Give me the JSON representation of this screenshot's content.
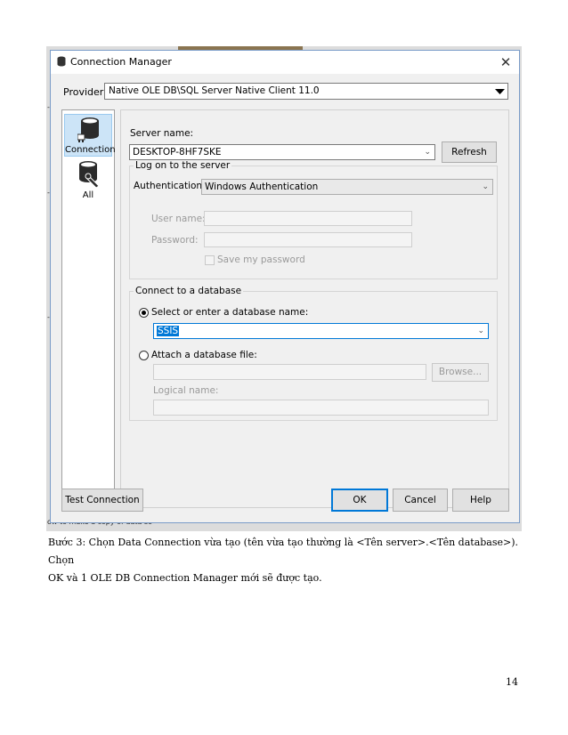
{
  "window": {
    "title": "Connection Manager",
    "close_symbol": "✕"
  },
  "provider": {
    "label": "Provider:",
    "value": "Native OLE DB\\SQL Server Native Client 11.0"
  },
  "nav": {
    "items": [
      {
        "label": "Connection",
        "icon": "database-plug-icon",
        "selected": true
      },
      {
        "label": "All",
        "icon": "database-wrench-icon",
        "selected": false
      }
    ]
  },
  "server": {
    "label": "Server name:",
    "value": "DESKTOP-8HF7SKE",
    "refresh_label": "Refresh"
  },
  "logon": {
    "group_label": "Log on to the server",
    "auth_label": "Authentication:",
    "auth_value": "Windows Authentication",
    "username_label": "User name:",
    "password_label": "Password:",
    "save_password_label": "Save my password"
  },
  "database": {
    "group_label": "Connect to a database",
    "select_label": "Select or enter a database name:",
    "select_value": "SSIS",
    "attach_label": "Attach a database file:",
    "browse_label": "Browse...",
    "logical_label": "Logical name:"
  },
  "footer": {
    "test_label": "Test Connection",
    "ok_label": "OK",
    "cancel_label": "Cancel",
    "help_label": "Help"
  },
  "background_fragment": "ow to make a copy of data so",
  "caption": {
    "line1": "Bước 3: Chọn Data Connection vừa tạo (tên vừa tạo thường là <Tên server>.<Tên database>). Chọn",
    "line2": "OK và 1 OLE DB Connection Manager mới sẽ được tạo."
  },
  "page_number": "14",
  "colors": {
    "accent": "#0078d7",
    "selection": "#cce4f7",
    "dialog_bg": "#f0f0f0"
  }
}
